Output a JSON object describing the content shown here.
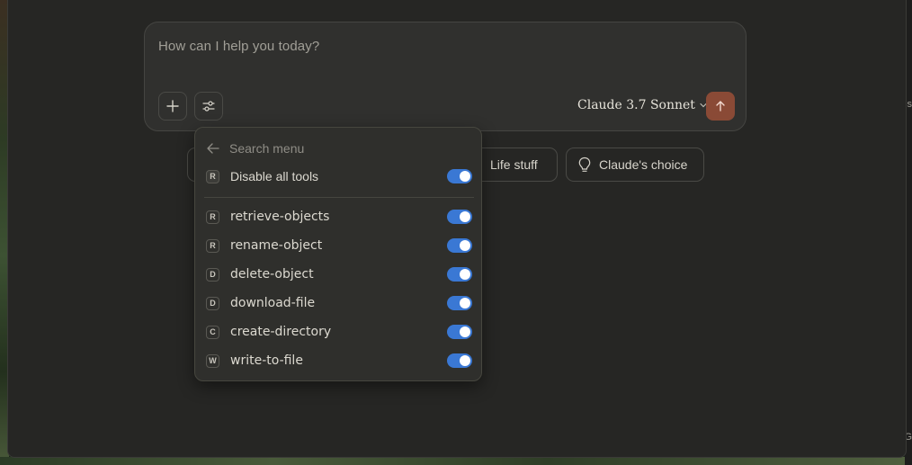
{
  "composer": {
    "placeholder": "How can I help you today?",
    "model": "Claude 3.7 Sonnet"
  },
  "chips": [
    {
      "label": "Life stuff",
      "icon": "coffee-icon"
    },
    {
      "label": "Claude's choice",
      "icon": "lightbulb-icon"
    }
  ],
  "tools_menu": {
    "search_placeholder": "Search menu",
    "disable_all": {
      "letter": "R",
      "label": "Disable all tools",
      "enabled": true
    },
    "tools": [
      {
        "letter": "R",
        "label": "retrieve-objects",
        "enabled": true
      },
      {
        "letter": "R",
        "label": "rename-object",
        "enabled": true
      },
      {
        "letter": "D",
        "label": "delete-object",
        "enabled": true
      },
      {
        "letter": "D",
        "label": "download-file",
        "enabled": true
      },
      {
        "letter": "C",
        "label": "create-directory",
        "enabled": true
      },
      {
        "letter": "W",
        "label": "write-to-file",
        "enabled": true
      }
    ]
  },
  "edge_glyphs": {
    "top": "s",
    "bottom": "G"
  },
  "colors": {
    "toggle_on": "#3a78d4",
    "send_button": "#8a4a36",
    "background": "#262624"
  }
}
